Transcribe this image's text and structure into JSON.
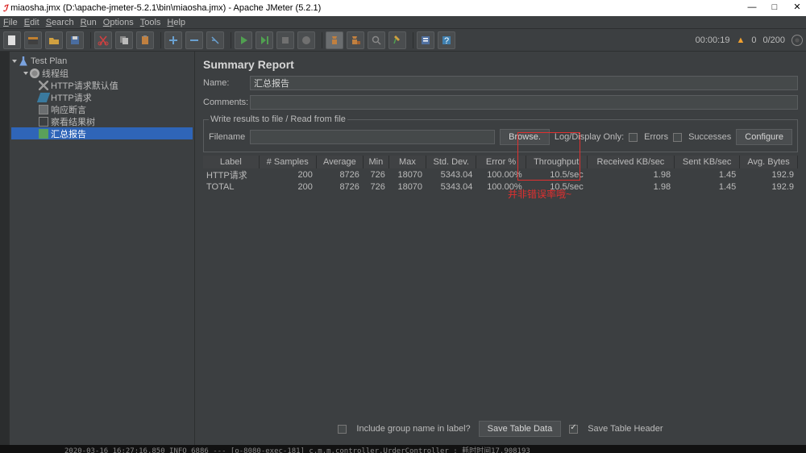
{
  "window": {
    "title": "miaosha.jmx (D:\\apache-jmeter-5.2.1\\bin\\miaosha.jmx) - Apache JMeter (5.2.1)"
  },
  "menu": [
    "File",
    "Edit",
    "Search",
    "Run",
    "Options",
    "Tools",
    "Help"
  ],
  "status": {
    "time": "00:00:19",
    "warn": "0",
    "run": "0/200"
  },
  "tree": {
    "plan": "Test Plan",
    "threadGroup": "线程组",
    "httpDefault": "HTTP请求默认值",
    "httpReq": "HTTP请求",
    "respAssert": "响应断言",
    "viewTree": "察看结果树",
    "summary": "汇总报告"
  },
  "report": {
    "title": "Summary Report",
    "nameLabel": "Name:",
    "name": "汇总报告",
    "commentsLabel": "Comments:",
    "comments": "",
    "legend": "Write results to file / Read from file",
    "filenameLabel": "Filename",
    "filename": "",
    "browse": "Browse.",
    "logDisplay": "Log/Display Only:",
    "errors": "Errors",
    "successes": "Successes",
    "configure": "Configure"
  },
  "table": {
    "headers": [
      "Label",
      "# Samples",
      "Average",
      "Min",
      "Max",
      "Std. Dev.",
      "Error %",
      "Throughput",
      "Received KB/sec",
      "Sent KB/sec",
      "Avg. Bytes"
    ],
    "rows": [
      [
        "HTTP请求",
        "200",
        "8726",
        "726",
        "18070",
        "5343.04",
        "100.00%",
        "10.5/sec",
        "1.98",
        "1.45",
        "192.9"
      ],
      [
        "TOTAL",
        "200",
        "8726",
        "726",
        "18070",
        "5343.04",
        "100.00%",
        "10.5/sec",
        "1.98",
        "1.45",
        "192.9"
      ]
    ]
  },
  "annotation": "并非错误率哦~",
  "footer": {
    "includeGroup": "Include group name in label?",
    "saveData": "Save Table Data",
    "saveHeader": "Save Table Header"
  },
  "bottom": "2020-03-16 16:27:16.850  INFO 6886 --- [o-8080-exec-181] c.m.m.controller.UrderController   : 耗时时间17.908193"
}
